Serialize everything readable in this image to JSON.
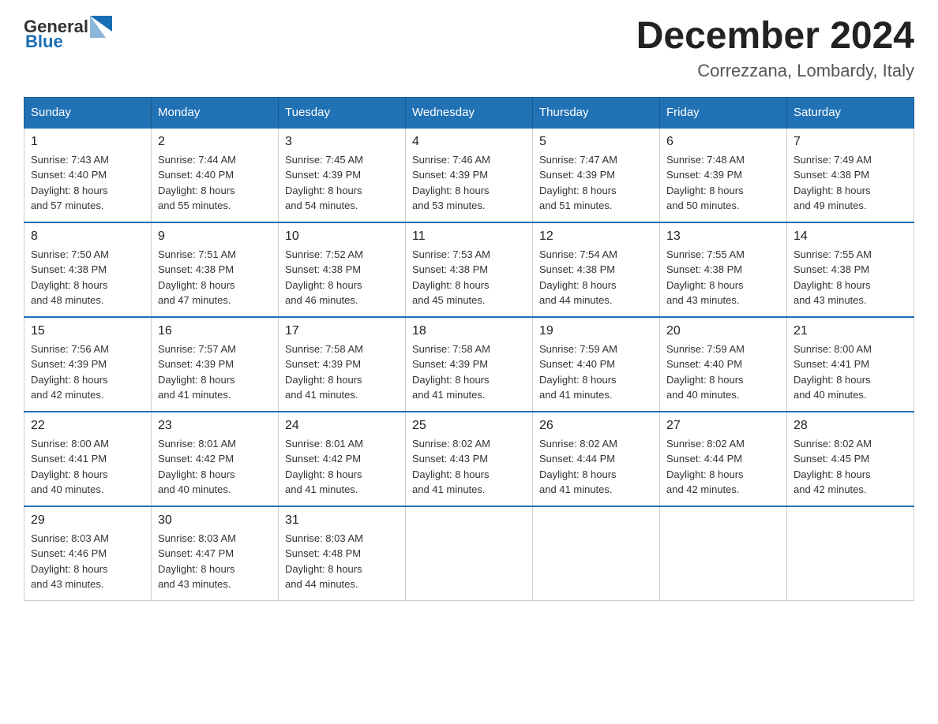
{
  "logo": {
    "general": "General",
    "blue": "Blue"
  },
  "title": "December 2024",
  "location": "Correzzana, Lombardy, Italy",
  "days_of_week": [
    "Sunday",
    "Monday",
    "Tuesday",
    "Wednesday",
    "Thursday",
    "Friday",
    "Saturday"
  ],
  "weeks": [
    [
      {
        "day": "1",
        "sunrise": "7:43 AM",
        "sunset": "4:40 PM",
        "daylight": "8 hours and 57 minutes."
      },
      {
        "day": "2",
        "sunrise": "7:44 AM",
        "sunset": "4:40 PM",
        "daylight": "8 hours and 55 minutes."
      },
      {
        "day": "3",
        "sunrise": "7:45 AM",
        "sunset": "4:39 PM",
        "daylight": "8 hours and 54 minutes."
      },
      {
        "day": "4",
        "sunrise": "7:46 AM",
        "sunset": "4:39 PM",
        "daylight": "8 hours and 53 minutes."
      },
      {
        "day": "5",
        "sunrise": "7:47 AM",
        "sunset": "4:39 PM",
        "daylight": "8 hours and 51 minutes."
      },
      {
        "day": "6",
        "sunrise": "7:48 AM",
        "sunset": "4:39 PM",
        "daylight": "8 hours and 50 minutes."
      },
      {
        "day": "7",
        "sunrise": "7:49 AM",
        "sunset": "4:38 PM",
        "daylight": "8 hours and 49 minutes."
      }
    ],
    [
      {
        "day": "8",
        "sunrise": "7:50 AM",
        "sunset": "4:38 PM",
        "daylight": "8 hours and 48 minutes."
      },
      {
        "day": "9",
        "sunrise": "7:51 AM",
        "sunset": "4:38 PM",
        "daylight": "8 hours and 47 minutes."
      },
      {
        "day": "10",
        "sunrise": "7:52 AM",
        "sunset": "4:38 PM",
        "daylight": "8 hours and 46 minutes."
      },
      {
        "day": "11",
        "sunrise": "7:53 AM",
        "sunset": "4:38 PM",
        "daylight": "8 hours and 45 minutes."
      },
      {
        "day": "12",
        "sunrise": "7:54 AM",
        "sunset": "4:38 PM",
        "daylight": "8 hours and 44 minutes."
      },
      {
        "day": "13",
        "sunrise": "7:55 AM",
        "sunset": "4:38 PM",
        "daylight": "8 hours and 43 minutes."
      },
      {
        "day": "14",
        "sunrise": "7:55 AM",
        "sunset": "4:38 PM",
        "daylight": "8 hours and 43 minutes."
      }
    ],
    [
      {
        "day": "15",
        "sunrise": "7:56 AM",
        "sunset": "4:39 PM",
        "daylight": "8 hours and 42 minutes."
      },
      {
        "day": "16",
        "sunrise": "7:57 AM",
        "sunset": "4:39 PM",
        "daylight": "8 hours and 41 minutes."
      },
      {
        "day": "17",
        "sunrise": "7:58 AM",
        "sunset": "4:39 PM",
        "daylight": "8 hours and 41 minutes."
      },
      {
        "day": "18",
        "sunrise": "7:58 AM",
        "sunset": "4:39 PM",
        "daylight": "8 hours and 41 minutes."
      },
      {
        "day": "19",
        "sunrise": "7:59 AM",
        "sunset": "4:40 PM",
        "daylight": "8 hours and 41 minutes."
      },
      {
        "day": "20",
        "sunrise": "7:59 AM",
        "sunset": "4:40 PM",
        "daylight": "8 hours and 40 minutes."
      },
      {
        "day": "21",
        "sunrise": "8:00 AM",
        "sunset": "4:41 PM",
        "daylight": "8 hours and 40 minutes."
      }
    ],
    [
      {
        "day": "22",
        "sunrise": "8:00 AM",
        "sunset": "4:41 PM",
        "daylight": "8 hours and 40 minutes."
      },
      {
        "day": "23",
        "sunrise": "8:01 AM",
        "sunset": "4:42 PM",
        "daylight": "8 hours and 40 minutes."
      },
      {
        "day": "24",
        "sunrise": "8:01 AM",
        "sunset": "4:42 PM",
        "daylight": "8 hours and 41 minutes."
      },
      {
        "day": "25",
        "sunrise": "8:02 AM",
        "sunset": "4:43 PM",
        "daylight": "8 hours and 41 minutes."
      },
      {
        "day": "26",
        "sunrise": "8:02 AM",
        "sunset": "4:44 PM",
        "daylight": "8 hours and 41 minutes."
      },
      {
        "day": "27",
        "sunrise": "8:02 AM",
        "sunset": "4:44 PM",
        "daylight": "8 hours and 42 minutes."
      },
      {
        "day": "28",
        "sunrise": "8:02 AM",
        "sunset": "4:45 PM",
        "daylight": "8 hours and 42 minutes."
      }
    ],
    [
      {
        "day": "29",
        "sunrise": "8:03 AM",
        "sunset": "4:46 PM",
        "daylight": "8 hours and 43 minutes."
      },
      {
        "day": "30",
        "sunrise": "8:03 AM",
        "sunset": "4:47 PM",
        "daylight": "8 hours and 43 minutes."
      },
      {
        "day": "31",
        "sunrise": "8:03 AM",
        "sunset": "4:48 PM",
        "daylight": "8 hours and 44 minutes."
      },
      null,
      null,
      null,
      null
    ]
  ],
  "labels": {
    "sunrise": "Sunrise:",
    "sunset": "Sunset:",
    "daylight": "Daylight:"
  }
}
